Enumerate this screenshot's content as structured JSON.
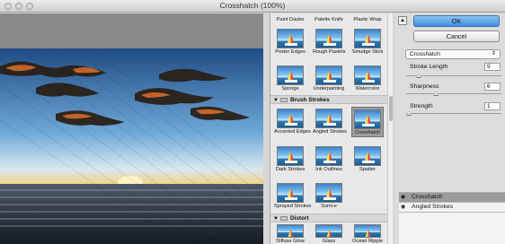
{
  "window": {
    "title": "Crosshatch (100%)"
  },
  "gallery": {
    "top_row": [
      {
        "label": "Paint Daubs"
      },
      {
        "label": "Palette Knife"
      },
      {
        "label": "Plastic Wrap"
      },
      {
        "label": "Poster Edges"
      },
      {
        "label": "Rough Pastels"
      },
      {
        "label": "Smudge Stick"
      },
      {
        "label": "Sponge"
      },
      {
        "label": "Underpainting"
      },
      {
        "label": "Watercolor"
      }
    ],
    "brush_strokes": {
      "title": "Brush Strokes",
      "items": [
        {
          "label": "Accented Edges"
        },
        {
          "label": "Angled Strokes"
        },
        {
          "label": "Crosshatch",
          "selected": true
        },
        {
          "label": "Dark Strokes"
        },
        {
          "label": "Ink Outlines"
        },
        {
          "label": "Spatter"
        },
        {
          "label": "Sprayed Strokes"
        },
        {
          "label": "Sumi-e"
        }
      ]
    },
    "distort": {
      "title": "Distort",
      "items": [
        {
          "label": "Diffuse Glow"
        },
        {
          "label": "Glass"
        },
        {
          "label": "Ocean Ripple"
        }
      ]
    }
  },
  "controls": {
    "ok_label": "OK",
    "cancel_label": "Cancel",
    "filter_select": "Crosshatch",
    "params": [
      {
        "label": "Stroke Length",
        "value": "9"
      },
      {
        "label": "Sharpness",
        "value": "6"
      },
      {
        "label": "Strength",
        "value": "1"
      }
    ],
    "layers": [
      {
        "label": "Crosshatch"
      },
      {
        "label": "Angled Strokes"
      }
    ],
    "icons": [
      "chevron-up-icon",
      "eye-icon",
      "folder-icon",
      "disclosure-triangle-icon"
    ]
  },
  "colors": {
    "accent": "#3f8ee0",
    "selection": "#9b9b9b"
  }
}
